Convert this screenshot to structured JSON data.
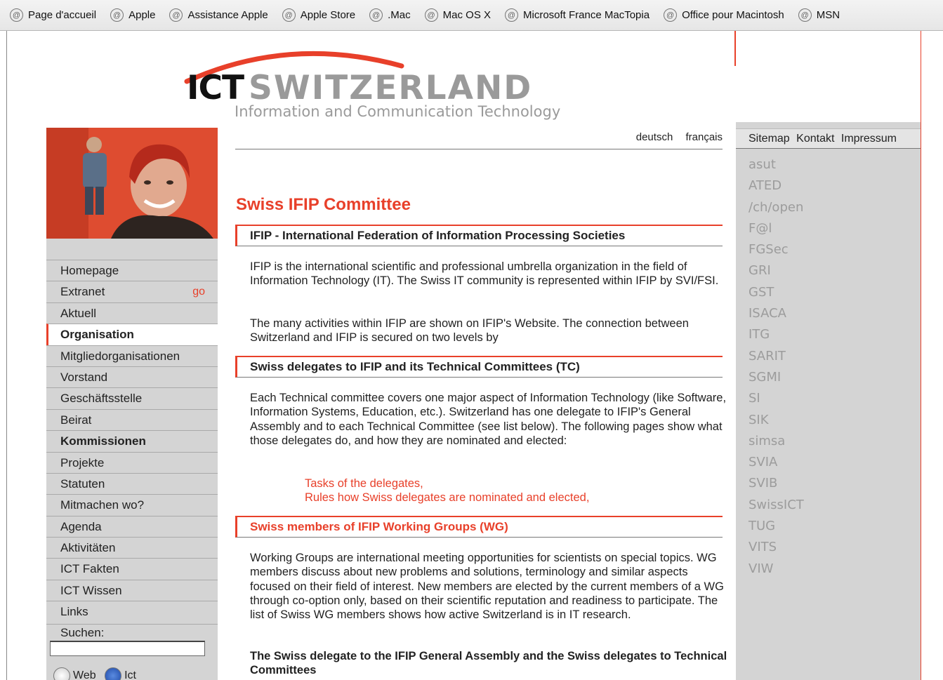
{
  "bookmarks": [
    "Page d'accueil",
    "Apple",
    "Assistance Apple",
    "Apple Store",
    ".Mac",
    "Mac OS X",
    "Microsoft France MacTopia",
    "Office pour Macintosh",
    "MSN"
  ],
  "logo": {
    "ict": "ICT",
    "switzerland": "SWITZERLAND",
    "tagline": "Information and Communication Technology"
  },
  "languages": [
    "deutsch",
    "français"
  ],
  "top_nav": [
    "Sitemap",
    "Kontakt",
    "Impressum"
  ],
  "left_nav": [
    {
      "label": "Homepage"
    },
    {
      "label": "Extranet",
      "go": "go"
    },
    {
      "label": "Aktuell"
    },
    {
      "label": "Organisation",
      "bold": true,
      "active": true
    },
    {
      "label": "Mitgliedorganisationen"
    },
    {
      "label": "Vorstand"
    },
    {
      "label": "Geschäftsstelle"
    },
    {
      "label": "Beirat"
    },
    {
      "label": "Kommissionen",
      "bold": true
    },
    {
      "label": "Projekte"
    },
    {
      "label": "Statuten"
    },
    {
      "label": "Mitmachen wo?"
    },
    {
      "label": "Agenda"
    },
    {
      "label": "Aktivitäten"
    },
    {
      "label": "ICT Fakten"
    },
    {
      "label": "ICT Wissen"
    },
    {
      "label": "Links"
    }
  ],
  "search": {
    "label": "Suchen:",
    "value": "",
    "radio_web_label": "Web",
    "radio_site_label": "Ict"
  },
  "main": {
    "title": "Swiss IFIP Committee",
    "section1_heading": "IFIP - International Federation of Information Processing Societies",
    "section1_para1": "IFIP is the international scientific and professional umbrella organization in the field of Information Technology (IT). The Swiss IT community is represented within IFIP by SVI/FSI.",
    "section1_para2": "The many activities within IFIP are shown on IFIP's Website. The connection between Switzerland and IFIP is secured on two levels by",
    "section2_heading": "Swiss delegates to IFIP and its Technical Committees (TC)",
    "section2_para": "Each Technical committee covers one major aspect of Information Technology (like Software, Information Systems, Education, etc.). Switzerland has one delegate to IFIP's General Assembly and to each Technical Committee (see list below). The following pages show what those delegates do, and how they are nominated and elected:",
    "links": [
      "Tasks of the delegates,",
      "Rules how Swiss delegates are nominated and elected,"
    ],
    "section3_heading": "Swiss members of IFIP Working Groups (WG)",
    "section3_para": "Working Groups are international meeting opportunities for scientists on special topics. WG members discuss about new problems and solutions, terminology and similar aspects focused on their field of interest. New members are elected by the current members of a WG through co-option only, based on their scientific reputation and readiness to participate. The list of Swiss WG members shows how active Switzerland is in IT research.",
    "bold_para": "The Swiss delegate to the IFIP General Assembly and the Swiss delegates to Technical Committees"
  },
  "member_orgs": [
    "asut",
    "ATED",
    "/ch/open",
    "F@l",
    "FGSec",
    "GRI",
    "GST",
    "ISACA",
    "ITG",
    "SARIT",
    "SGMI",
    "SI",
    "SIK",
    "simsa",
    "SVIA",
    "SVIB",
    "SwissICT",
    "TUG",
    "VITS",
    "VIW"
  ],
  "colors": {
    "accent": "#e8402a",
    "sidebar_gray": "#d4d4d4",
    "org_gray": "#9c9c9c"
  }
}
